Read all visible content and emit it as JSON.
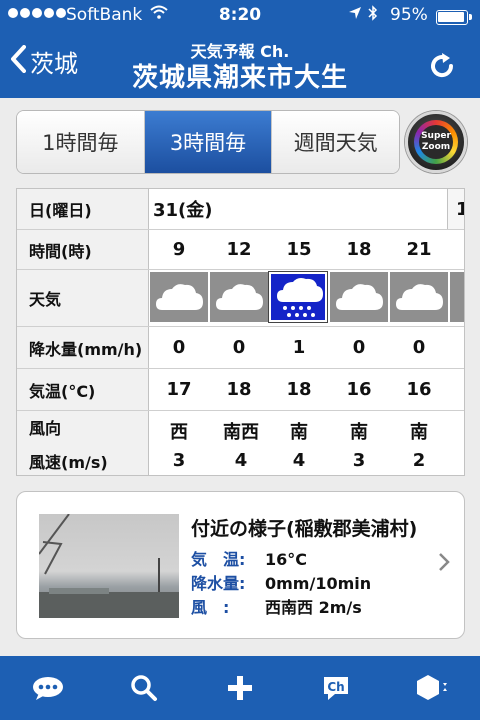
{
  "status": {
    "carrier": "SoftBank",
    "time": "8:20",
    "battery": "95%"
  },
  "nav": {
    "back_label": "茨城",
    "subtitle": "天気予報 Ch.",
    "title": "茨城県潮来市大生"
  },
  "tabs": [
    {
      "label": "1時間毎",
      "active": false
    },
    {
      "label": "3時間毎",
      "active": true
    },
    {
      "label": "週間天気",
      "active": false
    }
  ],
  "super_zoom": {
    "line1": "Super",
    "line2": "Zoom"
  },
  "forecast": {
    "labels": {
      "day": "日(曜日)",
      "time": "時間(時)",
      "weather": "天気",
      "precip": "降水量(mm/h)",
      "temp": "気温(°C)",
      "wind_dir": "風向",
      "wind_speed": "風速(m/s)"
    },
    "day": "31(金)",
    "next_day": "1",
    "hours": [
      "9",
      "12",
      "15",
      "18",
      "21"
    ],
    "weather": [
      "cloud-icon",
      "cloud-icon",
      "rain-icon",
      "cloud-icon",
      "cloud-icon"
    ],
    "precip": [
      "0",
      "0",
      "1",
      "0",
      "0"
    ],
    "temp": [
      "17",
      "18",
      "18",
      "16",
      "16"
    ],
    "wind_dir": [
      "西",
      "南西",
      "南",
      "南",
      "南"
    ],
    "wind_speed": [
      "3",
      "4",
      "4",
      "3",
      "2"
    ]
  },
  "nearby": {
    "title": "付近の様子(稲敷郡美浦村)",
    "temp_key": "気　温:",
    "temp_val": "16°C",
    "precip_key": "降水量:",
    "precip_val": "0mm/10min",
    "wind_key": "風　:",
    "wind_val": "西南西 2m/s"
  },
  "bottom_icons": [
    "chat-icon",
    "search-icon",
    "add-icon",
    "channel-icon",
    "menu-hex-icon"
  ],
  "colors": {
    "brand_blue": "#1d5fb3",
    "rain_blue": "#1424c8"
  }
}
